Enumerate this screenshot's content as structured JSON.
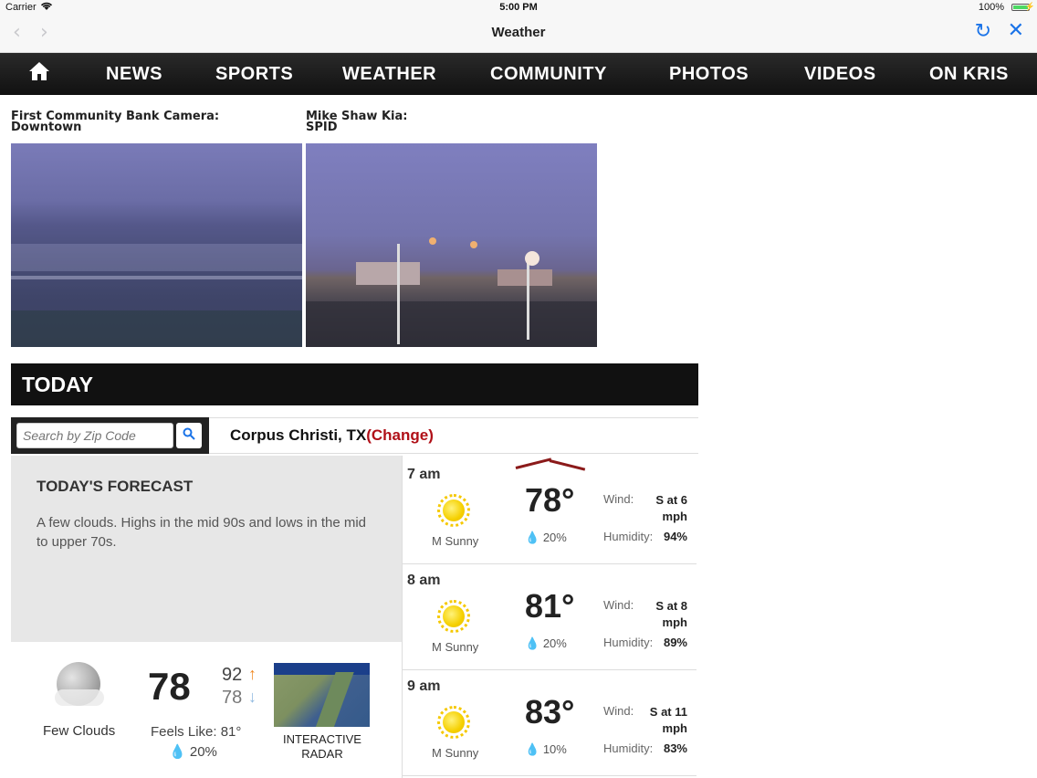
{
  "status_bar": {
    "carrier": "Carrier",
    "time": "5:00 PM",
    "battery": "100%"
  },
  "browser": {
    "title": "Weather"
  },
  "site_nav": {
    "items": [
      "NEWS",
      "SPORTS",
      "WEATHER",
      "COMMUNITY",
      "PHOTOS",
      "VIDEOS",
      "ON KRIS"
    ]
  },
  "cameras": [
    {
      "label_line1": "First Community Bank Camera:",
      "label_line2": "Downtown"
    },
    {
      "label_line1": "Mike Shaw Kia:",
      "label_line2": "SPID"
    }
  ],
  "today": {
    "heading": "TODAY"
  },
  "search": {
    "placeholder": "Search by Zip Code"
  },
  "location": {
    "city": "Corpus Christi, TX",
    "change_label": "(Change)"
  },
  "forecast": {
    "title": "TODAY'S FORECAST",
    "text": "A few clouds. Highs in the mid 90s and lows in the mid to upper 70s."
  },
  "current": {
    "condition": "Few Clouds",
    "temp": "78",
    "high": "92",
    "low": "78",
    "feels_like": "Feels Like: 81°",
    "precip": "20%"
  },
  "radar": {
    "label_line1": "INTERACTIVE",
    "label_line2": "RADAR"
  },
  "hourly": [
    {
      "time": "7 am",
      "condition": "M Sunny",
      "temp": "78°",
      "precip": "20%",
      "wind_label": "Wind:",
      "wind_line1": "S at 6",
      "wind_line2": "mph",
      "humidity_label": "Humidity:",
      "humidity": "94%"
    },
    {
      "time": "8 am",
      "condition": "M Sunny",
      "temp": "81°",
      "precip": "20%",
      "wind_label": "Wind:",
      "wind_line1": "S at 8",
      "wind_line2": "mph",
      "humidity_label": "Humidity:",
      "humidity": "89%"
    },
    {
      "time": "9 am",
      "condition": "M Sunny",
      "temp": "83°",
      "precip": "10%",
      "wind_label": "Wind:",
      "wind_line1": "S at 11",
      "wind_line2": "mph",
      "humidity_label": "Humidity:",
      "humidity": "83%"
    }
  ],
  "colors": {
    "accent_link": "#b01018",
    "ios_blue": "#1a73e8",
    "nav_bg": "#111111"
  },
  "icons": [
    "wifi-icon",
    "battery-icon",
    "back-icon",
    "forward-icon",
    "reload-icon",
    "close-icon",
    "home-icon",
    "search-icon",
    "moon-cloud-icon",
    "sun-icon",
    "raindrop-icon",
    "arrow-up-icon",
    "arrow-down-icon"
  ]
}
